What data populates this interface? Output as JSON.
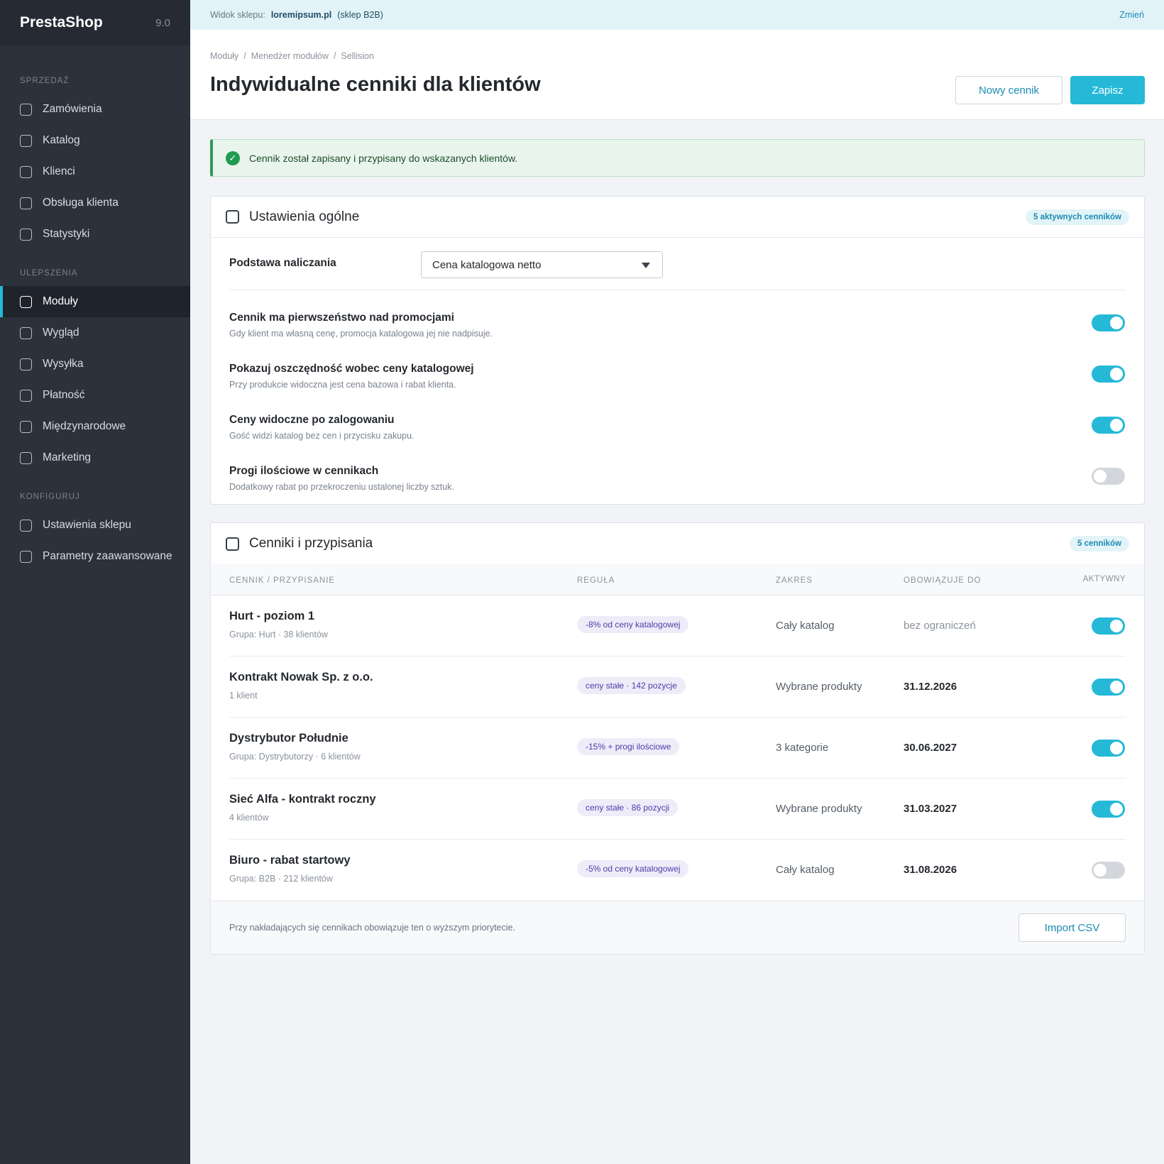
{
  "brand": {
    "name": "PrestaShop",
    "version": "9.0"
  },
  "sidebar": {
    "sections": [
      {
        "label": "SPRZEDAŻ",
        "items": [
          "Zamówienia",
          "Katalog",
          "Klienci",
          "Obsługa klienta",
          "Statystyki"
        ]
      },
      {
        "label": "ULEPSZENIA",
        "items": [
          "Moduły",
          "Wygląd",
          "Wysyłka",
          "Płatność",
          "Międzynarodowe",
          "Marketing"
        ]
      },
      {
        "label": "KONFIGURUJ",
        "items": [
          "Ustawienia sklepu",
          "Parametry zaawansowane"
        ]
      }
    ],
    "active_item": "Moduły"
  },
  "shopbar": {
    "label": "Widok sklepu:",
    "shop": "loremipsum.pl",
    "type": "(sklep B2B)",
    "change": "Zmień"
  },
  "breadcrumb": [
    "Moduły",
    "Menedżer modułów",
    "Sellision"
  ],
  "page_title": "Indywidualne cenniki dla klientów",
  "buttons": {
    "new": "Nowy cennik",
    "save": "Zapisz",
    "import": "Import CSV"
  },
  "alert": {
    "icon": "check-circle-icon",
    "text": "Cennik został zapisany i przypisany do wskazanych klientów."
  },
  "general": {
    "title": "Ustawienia ogólne",
    "badge": "5 aktywnych cenników",
    "basis_label": "Podstawa naliczania",
    "basis_value": "Cena katalogowa netto",
    "settings": [
      {
        "title": "Cennik ma pierwszeństwo nad promocjami",
        "desc": "Gdy klient ma własną cenę, promocja katalogowa jej nie nadpisuje.",
        "on": true
      },
      {
        "title": "Pokazuj oszczędność wobec ceny katalogowej",
        "desc": "Przy produkcie widoczna jest cena bazowa i rabat klienta.",
        "on": true
      },
      {
        "title": "Ceny widoczne po zalogowaniu",
        "desc": "Gość widzi katalog bez cen i przycisku zakupu.",
        "on": true
      },
      {
        "title": "Progi ilościowe w cennikach",
        "desc": "Dodatkowy rabat po przekroczeniu ustalonej liczby sztuk.",
        "on": false
      }
    ]
  },
  "pricelists": {
    "title": "Cenniki i przypisania",
    "badge": "5 cenników",
    "columns": {
      "name": "CENNIK / PRZYPISANIE",
      "rule": "REGUŁA",
      "scope": "ZAKRES",
      "valid": "OBOWIĄZUJE DO",
      "active": "AKTYWNY"
    },
    "rows": [
      {
        "name": "Hurt - poziom 1",
        "sub": "Grupa: Hurt · 38 klientów",
        "rule": "-8% od ceny katalogowej",
        "scope": "Cały katalog",
        "valid": "bez ograniczeń",
        "active": true
      },
      {
        "name": "Kontrakt Nowak Sp. z o.o.",
        "sub": "1 klient",
        "rule": "ceny stałe · 142 pozycje",
        "scope": "Wybrane produkty",
        "valid": "31.12.2026",
        "active": true
      },
      {
        "name": "Dystrybutor Południe",
        "sub": "Grupa: Dystrybutorzy · 6 klientów",
        "rule": "-15% + progi ilościowe",
        "scope": "3 kategorie",
        "valid": "30.06.2027",
        "active": true
      },
      {
        "name": "Sieć Alfa - kontrakt roczny",
        "sub": "4 klientów",
        "rule": "ceny stałe · 86 pozycji",
        "scope": "Wybrane produkty",
        "valid": "31.03.2027",
        "active": true
      },
      {
        "name": "Biuro - rabat startowy",
        "sub": "Grupa: B2B · 212 klientów",
        "rule": "-5% od ceny katalogowej",
        "scope": "Cały katalog",
        "valid": "31.08.2026",
        "active": false
      }
    ],
    "footer_note": "Przy nakładających się cennikach obowiązuje ten o wyższym priorytecie."
  },
  "colors": {
    "accent": "#25b9d7",
    "sidebar": "#2c313b",
    "success": "#1f9b52",
    "rule_badge": "#eeecf9"
  }
}
